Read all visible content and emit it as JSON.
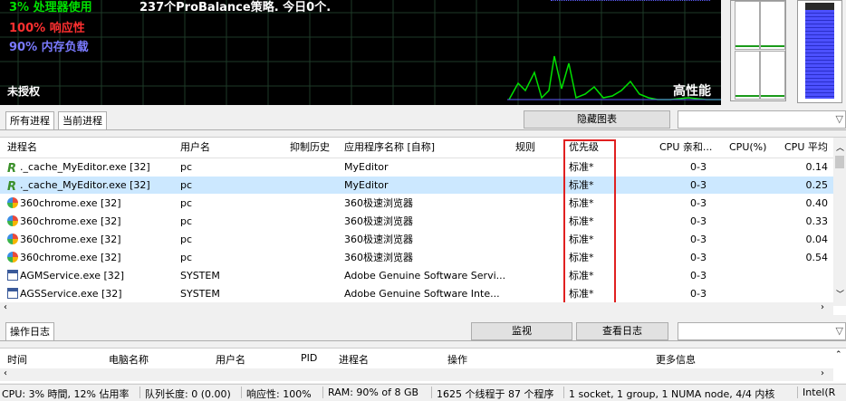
{
  "graph": {
    "cpu_stat": "3% 处理器使用",
    "resp_stat": "100% 响应性",
    "mem_stat": "90% 内存负载",
    "message": "237个ProBalance策略. 今日0个.",
    "license": "未授权",
    "power_plan": "高性能",
    "colors": {
      "cpu": "#00e000",
      "resp": "#ff3030",
      "mem": "#8080ff",
      "grid": "#1e3a28"
    }
  },
  "tabs": {
    "all": "所有进程",
    "current": "当前进程"
  },
  "hide_chart_button": "隐藏图表",
  "process_table": {
    "columns": {
      "name": "进程名",
      "user": "用户名",
      "history": "抑制历史",
      "app": "应用程序名称 [自称]",
      "rules": "规则",
      "priority": "优先级",
      "affinity": "CPU 亲和...",
      "cpu": "CPU(%)",
      "cpu_avg": "CPU 平均"
    },
    "rows": [
      {
        "name": "._cache_MyEditor.exe [32]",
        "icon": "r-icon",
        "user": "pc",
        "app": "MyEditor",
        "priority": "标准*",
        "affinity": "0-3",
        "cpu": "",
        "cpu_avg": "0.14",
        "selected": false
      },
      {
        "name": "._cache_MyEditor.exe [32]",
        "icon": "r-icon",
        "user": "pc",
        "app": "MyEditor",
        "priority": "标准*",
        "affinity": "0-3",
        "cpu": "",
        "cpu_avg": "0.25",
        "selected": true
      },
      {
        "name": "360chrome.exe [32]",
        "icon": "chrome360-icon",
        "user": "pc",
        "app": "360极速浏览器",
        "priority": "标准*",
        "affinity": "0-3",
        "cpu": "",
        "cpu_avg": "0.40",
        "selected": false
      },
      {
        "name": "360chrome.exe [32]",
        "icon": "chrome360-icon",
        "user": "pc",
        "app": "360极速浏览器",
        "priority": "标准*",
        "affinity": "0-3",
        "cpu": "",
        "cpu_avg": "0.33",
        "selected": false
      },
      {
        "name": "360chrome.exe [32]",
        "icon": "chrome360-icon",
        "user": "pc",
        "app": "360极速浏览器",
        "priority": "标准*",
        "affinity": "0-3",
        "cpu": "",
        "cpu_avg": "0.04",
        "selected": false
      },
      {
        "name": "360chrome.exe [32]",
        "icon": "chrome360-icon",
        "user": "pc",
        "app": "360极速浏览器",
        "priority": "标准*",
        "affinity": "0-3",
        "cpu": "",
        "cpu_avg": "0.54",
        "selected": false
      },
      {
        "name": "AGMService.exe [32]",
        "icon": "service-icon",
        "user": "SYSTEM",
        "app": "Adobe Genuine Software Servi...",
        "priority": "标准*",
        "affinity": "0-3",
        "cpu": "",
        "cpu_avg": "",
        "selected": false
      },
      {
        "name": "AGSService.exe [32]",
        "icon": "service-icon",
        "user": "SYSTEM",
        "app": "Adobe Genuine Software Inte...",
        "priority": "标准*",
        "affinity": "0-3",
        "cpu": "",
        "cpu_avg": "",
        "selected": false
      }
    ]
  },
  "log": {
    "tab": "操作日志",
    "monitor_button": "监视",
    "view_log_button": "查看日志",
    "columns": {
      "time": "时间",
      "computer": "电脑名称",
      "user": "用户名",
      "pid": "PID",
      "process": "进程名",
      "action": "操作",
      "more": "更多信息"
    }
  },
  "status": {
    "cpu": "CPU: 3% 時間, 12% 佔用率",
    "queue": "队列长度: 0 (0.00)",
    "resp": "响应性: 100%",
    "ram": "RAM: 90% of 8 GB",
    "threads": "1625 个线程于 87 个程序",
    "socket": "1 socket, 1 group, 1 NUMA node, 4/4 内核",
    "cpu_model": "Intel(R"
  }
}
